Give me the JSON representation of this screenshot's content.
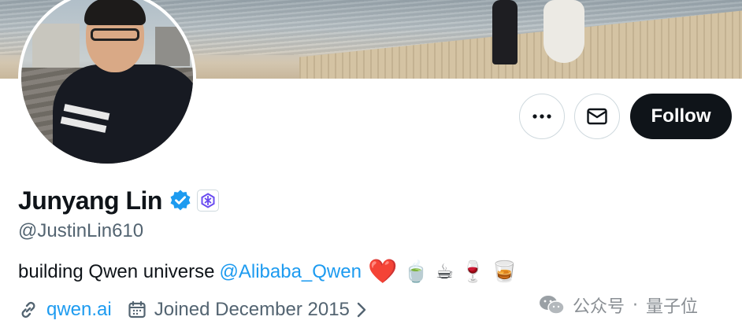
{
  "banner": {
    "description_icon": "beach-photo"
  },
  "avatar": {
    "icon": "profile-photo"
  },
  "actions": {
    "more_icon": "ellipsis-icon",
    "message_icon": "envelope-icon",
    "follow_label": "Follow"
  },
  "profile": {
    "name": "Junyang Lin",
    "verified_icon": "verified-badge-icon",
    "affiliation_icon": "qwen-logo-icon",
    "handle": "@JustinLin610",
    "bio": {
      "text": "building Qwen universe",
      "mention": "@Alibaba_Qwen",
      "emojis": [
        "❤️",
        "🍵",
        "☕",
        "🍷",
        "🥃"
      ]
    },
    "website": "qwen.ai",
    "joined": "Joined December 2015"
  },
  "watermark": {
    "left": "公众号",
    "separator": "·",
    "right": "量子位"
  },
  "colors": {
    "accent": "#1d9bf0",
    "text_primary": "#0f1419",
    "text_secondary": "#536471",
    "follow_bg": "#0f1419"
  }
}
